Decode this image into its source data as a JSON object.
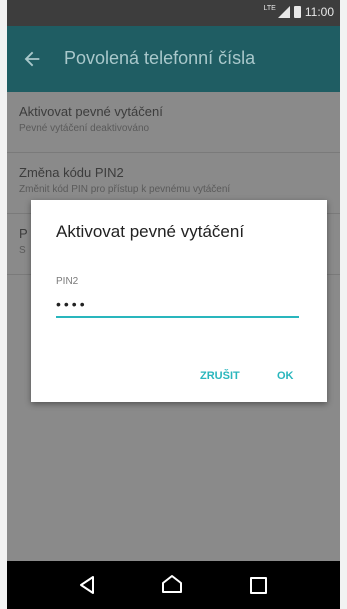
{
  "statusbar": {
    "network": "LTE",
    "time": "11:00"
  },
  "toolbar": {
    "title": "Povolená telefonní čísla",
    "back_icon": "arrow-back-icon"
  },
  "list": [
    {
      "title": "Aktivovat pevné vytáčení",
      "subtitle": "Pevné vytáčení deaktivováno"
    },
    {
      "title": "Změna kódu PIN2",
      "subtitle": "Změnit kód PIN pro přístup k pevnému vytáčení"
    },
    {
      "title": "P",
      "subtitle": "S"
    }
  ],
  "dialog": {
    "title": "Aktivovat pevné vytáčení",
    "field_label": "PIN2",
    "field_value": "••••",
    "cancel_label": "ZRUŠIT",
    "ok_label": "OK"
  },
  "colors": {
    "accent": "#29b6bd",
    "toolbar": "#1f5d63"
  }
}
